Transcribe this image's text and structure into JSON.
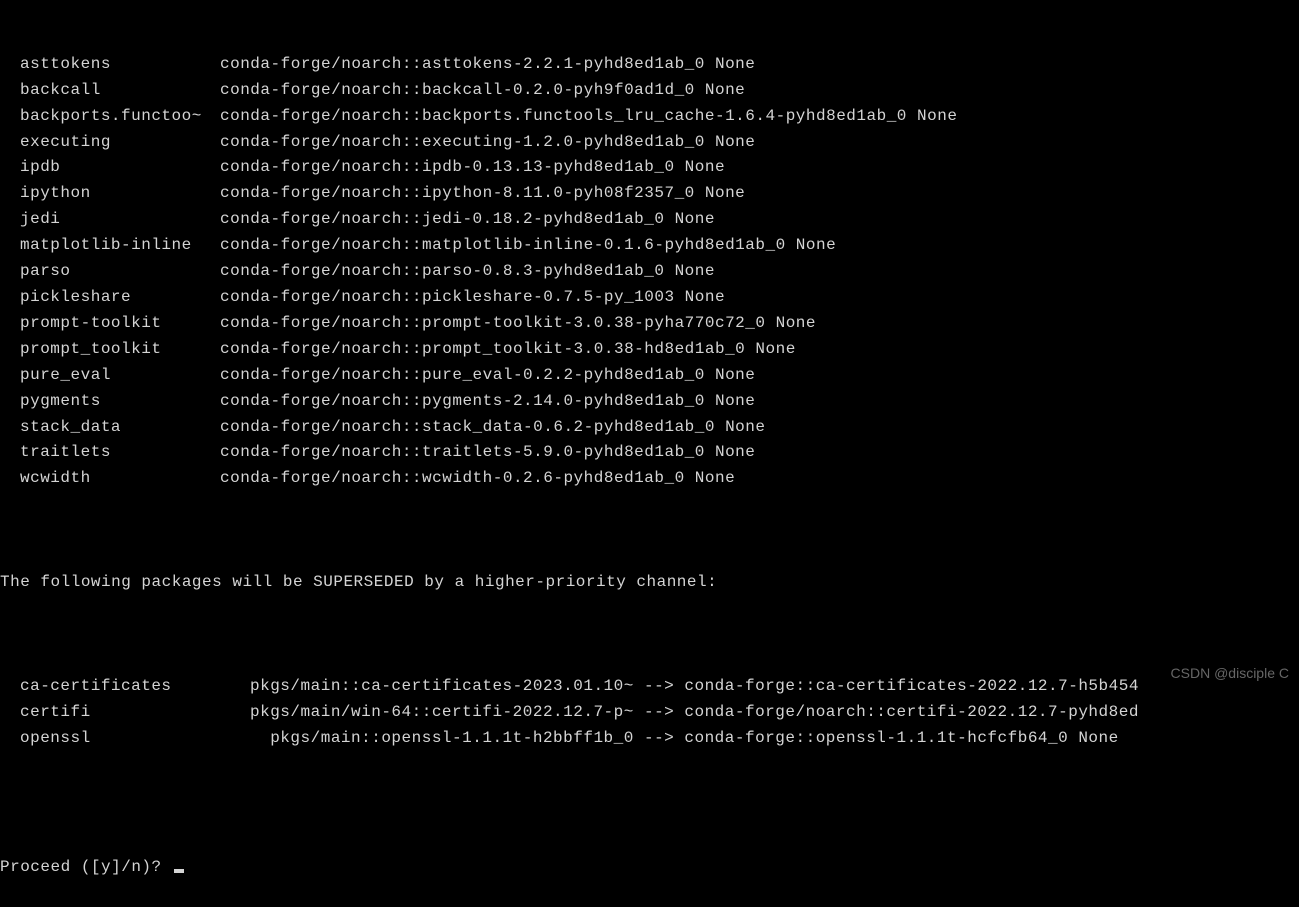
{
  "packages": [
    {
      "name": "asttokens",
      "spec": "conda-forge/noarch::asttokens-2.2.1-pyhd8ed1ab_0 None"
    },
    {
      "name": "backcall",
      "spec": "conda-forge/noarch::backcall-0.2.0-pyh9f0ad1d_0 None"
    },
    {
      "name": "backports.functoo~",
      "spec": "conda-forge/noarch::backports.functools_lru_cache-1.6.4-pyhd8ed1ab_0 None"
    },
    {
      "name": "executing",
      "spec": "conda-forge/noarch::executing-1.2.0-pyhd8ed1ab_0 None"
    },
    {
      "name": "ipdb",
      "spec": "conda-forge/noarch::ipdb-0.13.13-pyhd8ed1ab_0 None"
    },
    {
      "name": "ipython",
      "spec": "conda-forge/noarch::ipython-8.11.0-pyh08f2357_0 None"
    },
    {
      "name": "jedi",
      "spec": "conda-forge/noarch::jedi-0.18.2-pyhd8ed1ab_0 None"
    },
    {
      "name": "matplotlib-inline",
      "spec": "conda-forge/noarch::matplotlib-inline-0.1.6-pyhd8ed1ab_0 None"
    },
    {
      "name": "parso",
      "spec": "conda-forge/noarch::parso-0.8.3-pyhd8ed1ab_0 None"
    },
    {
      "name": "pickleshare",
      "spec": "conda-forge/noarch::pickleshare-0.7.5-py_1003 None"
    },
    {
      "name": "prompt-toolkit",
      "spec": "conda-forge/noarch::prompt-toolkit-3.0.38-pyha770c72_0 None"
    },
    {
      "name": "prompt_toolkit",
      "spec": "conda-forge/noarch::prompt_toolkit-3.0.38-hd8ed1ab_0 None"
    },
    {
      "name": "pure_eval",
      "spec": "conda-forge/noarch::pure_eval-0.2.2-pyhd8ed1ab_0 None"
    },
    {
      "name": "pygments",
      "spec": "conda-forge/noarch::pygments-2.14.0-pyhd8ed1ab_0 None"
    },
    {
      "name": "stack_data",
      "spec": "conda-forge/noarch::stack_data-0.6.2-pyhd8ed1ab_0 None"
    },
    {
      "name": "traitlets",
      "spec": "conda-forge/noarch::traitlets-5.9.0-pyhd8ed1ab_0 None"
    },
    {
      "name": "wcwidth",
      "spec": "conda-forge/noarch::wcwidth-0.2.6-pyhd8ed1ab_0 None"
    }
  ],
  "superseded_header": "The following packages will be SUPERSEDED by a higher-priority channel:",
  "superseded": [
    {
      "name": "ca-certificates",
      "spec": "pkgs/main::ca-certificates-2023.01.10~ --> conda-forge::ca-certificates-2022.12.7-h5b454"
    },
    {
      "name": "certifi",
      "spec": "pkgs/main/win-64::certifi-2022.12.7-p~ --> conda-forge/noarch::certifi-2022.12.7-pyhd8ed"
    },
    {
      "name": "openssl",
      "spec": "  pkgs/main::openssl-1.1.1t-h2bbff1b_0 --> conda-forge::openssl-1.1.1t-hcfcfb64_0 None"
    }
  ],
  "prompt": "Proceed ([y]/n)? ",
  "watermark": "CSDN @disciple C"
}
